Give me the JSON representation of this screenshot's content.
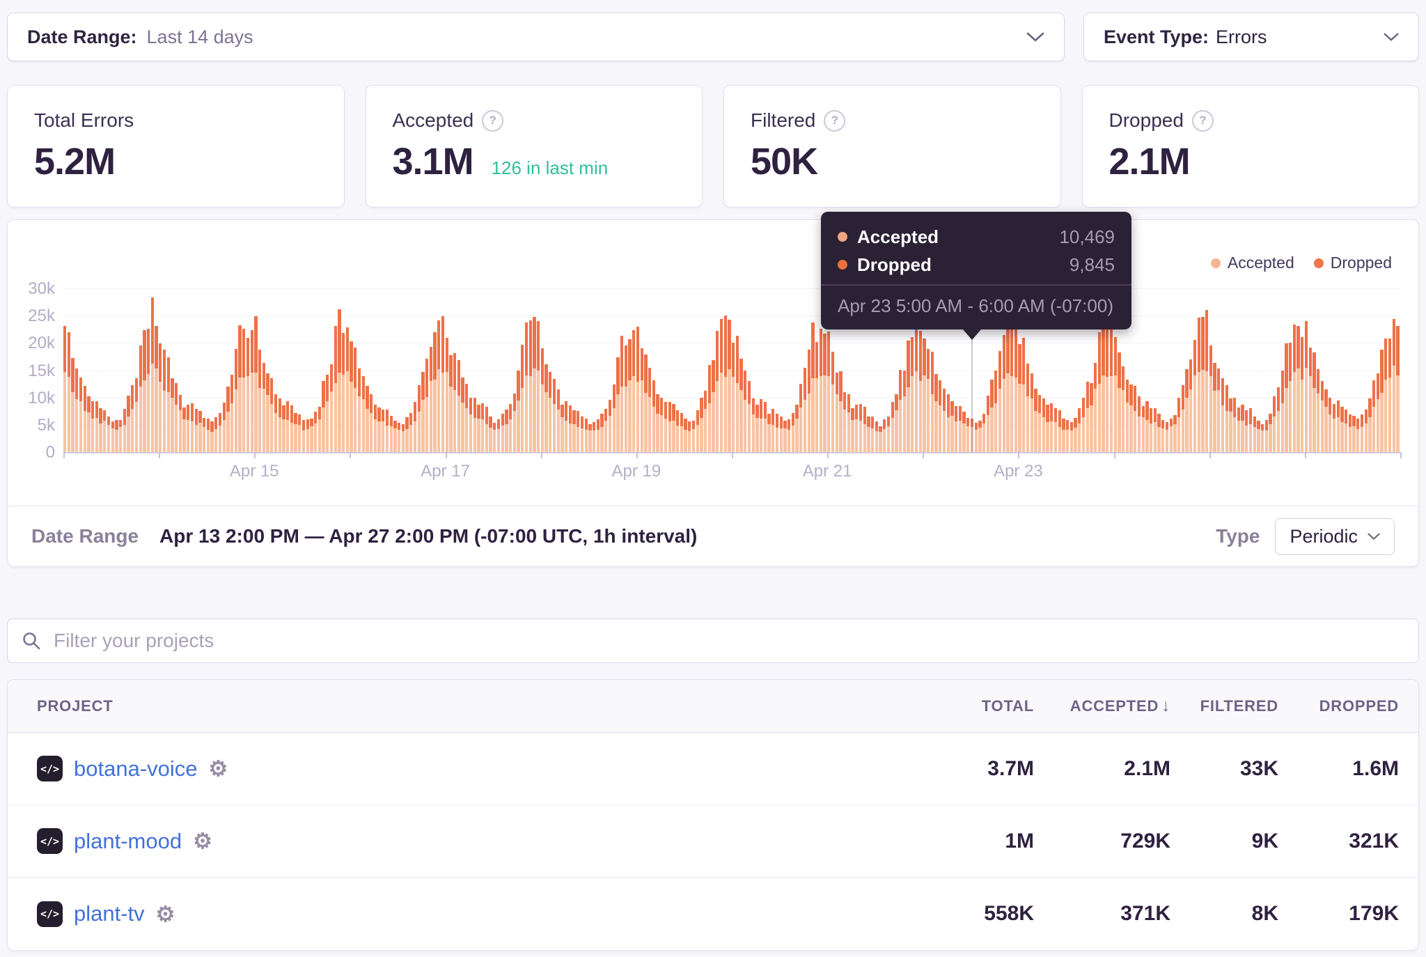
{
  "filters": {
    "date_range_label": "Date Range:",
    "date_range_value": "Last 14 days",
    "event_type_label": "Event Type:",
    "event_type_value": "Errors"
  },
  "cards": [
    {
      "label": "Total Errors",
      "value": "5.2M"
    },
    {
      "label": "Accepted",
      "value": "3.1M",
      "extra": "126 in last min"
    },
    {
      "label": "Filtered",
      "value": "50K"
    },
    {
      "label": "Dropped",
      "value": "2.1M"
    }
  ],
  "legend": [
    {
      "label": "Accepted",
      "color": "#f7b493"
    },
    {
      "label": "Dropped",
      "color": "#f1744a"
    }
  ],
  "tooltip": {
    "rows": [
      {
        "label": "Accepted",
        "value": "10,469"
      },
      {
        "label": "Dropped",
        "value": "9,845"
      }
    ],
    "footer": "Apr 23 5:00 AM - 6:00 AM (-07:00)"
  },
  "chart_data": {
    "type": "bar",
    "stacked": true,
    "series_names": [
      "Accepted",
      "Dropped"
    ],
    "colors": {
      "accepted": "#f9c3a3",
      "dropped": "#ee7148"
    },
    "x_start": "Apr 13 2:00 PM",
    "x_end": "Apr 27 2:00 PM",
    "interval": "1h",
    "days": 14,
    "hours_per_day": 24,
    "start_hour": 14,
    "ylim": [
      0,
      30000
    ],
    "y_ticks": [
      "0",
      "5k",
      "10k",
      "15k",
      "20k",
      "25k",
      "30k"
    ],
    "x_tick_labels": [
      {
        "label": "Apr 15",
        "day": 2
      },
      {
        "label": "Apr 17",
        "day": 4
      },
      {
        "label": "Apr 19",
        "day": 6
      },
      {
        "label": "Apr 21",
        "day": 8
      },
      {
        "label": "Apr 23",
        "day": 10
      }
    ],
    "hourly_profile_accepted": [
      5.2,
      4.7,
      4.3,
      4.1,
      4.4,
      5.1,
      6.3,
      7.9,
      9.6,
      11.4,
      13.2,
      14.4,
      15.0,
      14.7,
      13.9,
      12.6,
      11.1,
      9.7,
      8.5,
      7.5,
      6.7,
      6.2,
      5.8,
      5.5
    ],
    "hourly_profile_dropped": [
      2.6,
      2.1,
      1.7,
      1.5,
      1.8,
      2.3,
      3.1,
      4.3,
      5.6,
      6.9,
      8.1,
      9.0,
      9.6,
      9.1,
      8.3,
      7.1,
      6.0,
      5.0,
      4.2,
      3.6,
      3.2,
      3.0,
      2.8,
      2.7
    ],
    "day_multipliers": [
      1.04,
      0.96,
      1.0,
      0.94,
      1.02,
      0.9,
      0.97,
      1.0,
      0.93,
      1.01,
      0.95,
      0.99,
      0.96,
      1.03
    ],
    "jitter": {
      "seed": 42,
      "accepted": 0.08,
      "dropped": 0.3
    },
    "hover": {
      "x_label": "Apr 23 5:00 AM - 6:00 AM (-07:00)",
      "accepted": 10469,
      "dropped": 9845
    }
  },
  "panel_footer": {
    "label": "Date Range",
    "value": "Apr 13 2:00 PM — Apr 27 2:00 PM (-07:00 UTC, 1h interval)",
    "type_label": "Type",
    "type_value": "Periodic"
  },
  "search": {
    "placeholder": "Filter your projects"
  },
  "table": {
    "columns": [
      "PROJECT",
      "TOTAL",
      "ACCEPTED",
      "FILTERED",
      "DROPPED"
    ],
    "sorted_by": "ACCEPTED",
    "sort_arrow": "↓",
    "project_icon_glyph": "</>",
    "rows": [
      {
        "project": "botana-voice",
        "total": "3.7M",
        "accepted": "2.1M",
        "filtered": "33K",
        "dropped": "1.6M"
      },
      {
        "project": "plant-mood",
        "total": "1M",
        "accepted": "729K",
        "filtered": "9K",
        "dropped": "321K"
      },
      {
        "project": "plant-tv",
        "total": "558K",
        "accepted": "371K",
        "filtered": "8K",
        "dropped": "179K"
      }
    ]
  }
}
